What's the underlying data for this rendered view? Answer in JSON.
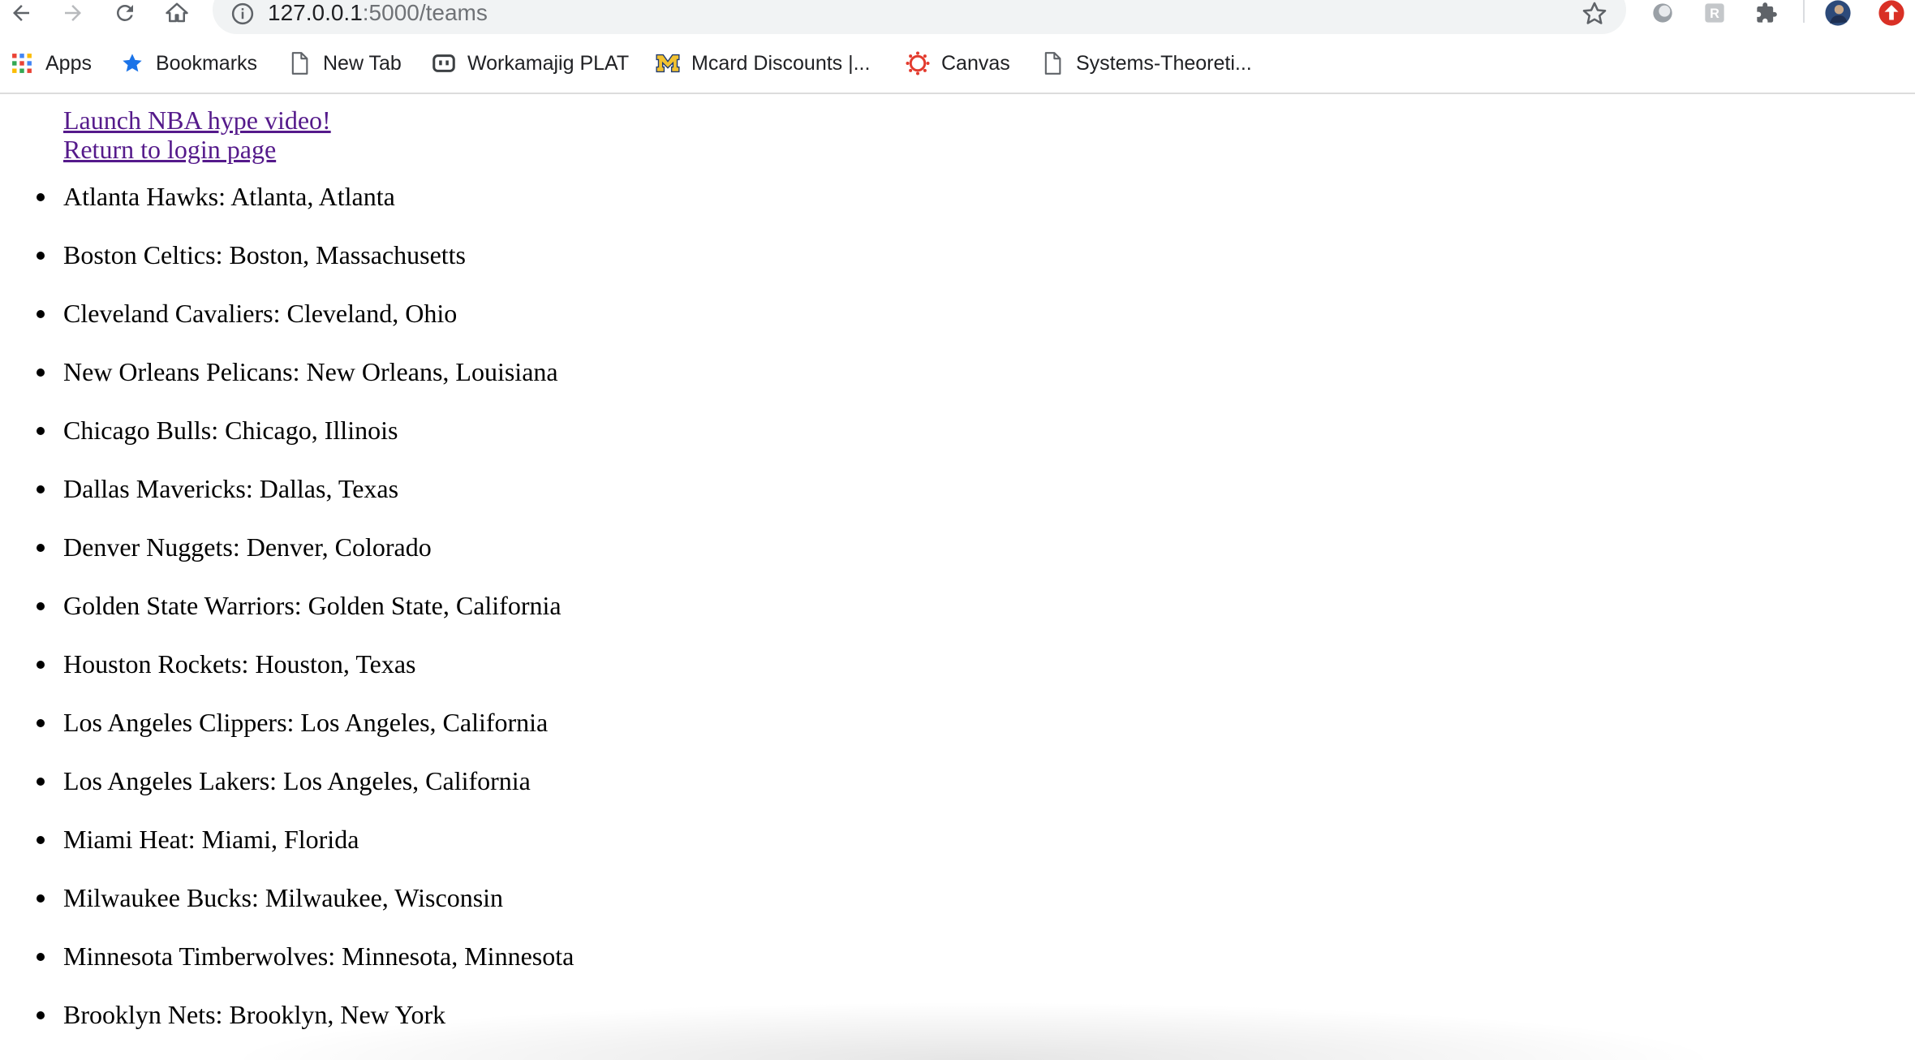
{
  "browser": {
    "url_host": "127.0.0.1",
    "url_rest": ":5000/teams",
    "bookmarks": [
      {
        "label": "Apps",
        "icon": "apps-grid-icon"
      },
      {
        "label": "Bookmarks",
        "icon": "star-icon"
      },
      {
        "label": "New Tab",
        "icon": "page-icon"
      },
      {
        "label": "Workamajig PLAT",
        "icon": "workamajig-icon"
      },
      {
        "label": "Mcard Discounts |...",
        "icon": "michigan-m-icon"
      },
      {
        "label": "Canvas",
        "icon": "canvas-icon"
      },
      {
        "label": "Systems-Theoreti...",
        "icon": "page-icon"
      }
    ]
  },
  "page": {
    "links": {
      "hype_video": "Launch NBA hype video!",
      "login": "Return to login page"
    },
    "teams": [
      "Atlanta Hawks: Atlanta, Atlanta",
      "Boston Celtics: Boston, Massachusetts",
      "Cleveland Cavaliers: Cleveland, Ohio",
      "New Orleans Pelicans: New Orleans, Louisiana",
      "Chicago Bulls: Chicago, Illinois",
      "Dallas Mavericks: Dallas, Texas",
      "Denver Nuggets: Denver, Colorado",
      "Golden State Warriors: Golden State, California",
      "Houston Rockets: Houston, Texas",
      "Los Angeles Clippers: Los Angeles, California",
      "Los Angeles Lakers: Los Angeles, California",
      "Miami Heat: Miami, Florida",
      "Milwaukee Bucks: Milwaukee, Wisconsin",
      "Minnesota Timberwolves: Minnesota, Minnesota",
      "Brooklyn Nets: Brooklyn, New York"
    ]
  },
  "colors": {
    "link_visited": "#551a8b",
    "omnibox_bg": "#f1f3f4",
    "icon_gray": "#5f6368"
  }
}
